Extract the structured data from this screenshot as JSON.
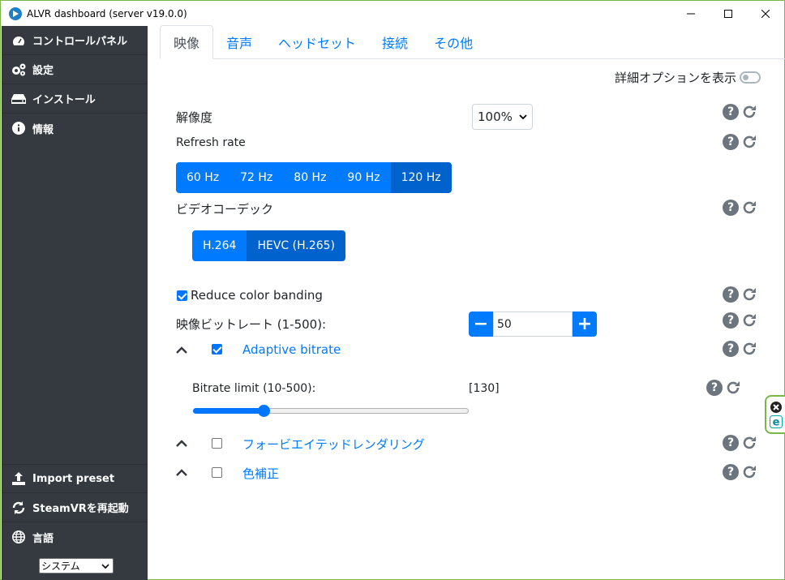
{
  "window": {
    "title": "ALVR dashboard (server v19.0.0)"
  },
  "sidebar": {
    "items": [
      {
        "label": "コントロールパネル",
        "icon": "dashboard-icon"
      },
      {
        "label": "設定",
        "icon": "gears-icon"
      },
      {
        "label": "インストール",
        "icon": "hdd-icon"
      },
      {
        "label": "情報",
        "icon": "info-icon"
      }
    ],
    "bottom_items": [
      {
        "label": "Import preset",
        "icon": "upload-icon"
      },
      {
        "label": "SteamVRを再起動",
        "icon": "sync-icon"
      },
      {
        "label": "言語",
        "icon": "globe-icon"
      }
    ],
    "language_value": "システム"
  },
  "tabs": [
    {
      "label": "映像",
      "active": true
    },
    {
      "label": "音声"
    },
    {
      "label": "ヘッドセット"
    },
    {
      "label": "接続"
    },
    {
      "label": "その他"
    }
  ],
  "advanced_toggle_label": "詳細オプションを表示",
  "resolution": {
    "label": "解像度",
    "value": "100%"
  },
  "refresh_rate": {
    "label": "Refresh rate",
    "options": [
      "60 Hz",
      "72 Hz",
      "80 Hz",
      "90 Hz",
      "120 Hz"
    ],
    "selected": "120 Hz"
  },
  "codec": {
    "label": "ビデオコーデック",
    "options": [
      "H.264",
      "HEVC (H.265)"
    ],
    "selected": "HEVC (H.265)"
  },
  "reduce_color_banding": {
    "label": "Reduce color banding",
    "checked": true
  },
  "bitrate": {
    "label": "映像ビットレート (1-500):",
    "value": "50"
  },
  "adaptive_bitrate": {
    "label": "Adaptive bitrate",
    "checked": true
  },
  "bitrate_limit": {
    "label": "Bitrate limit (10-500):",
    "value_display": "[130]",
    "value": 130,
    "min": 10,
    "max": 500
  },
  "foveated": {
    "label": "フォービエイテッドレンダリング",
    "checked": false
  },
  "color_correction": {
    "label": "色補正",
    "checked": false
  },
  "colors": {
    "accent": "#007bff",
    "sidebar": "#343a40",
    "frame": "#7ab648"
  }
}
